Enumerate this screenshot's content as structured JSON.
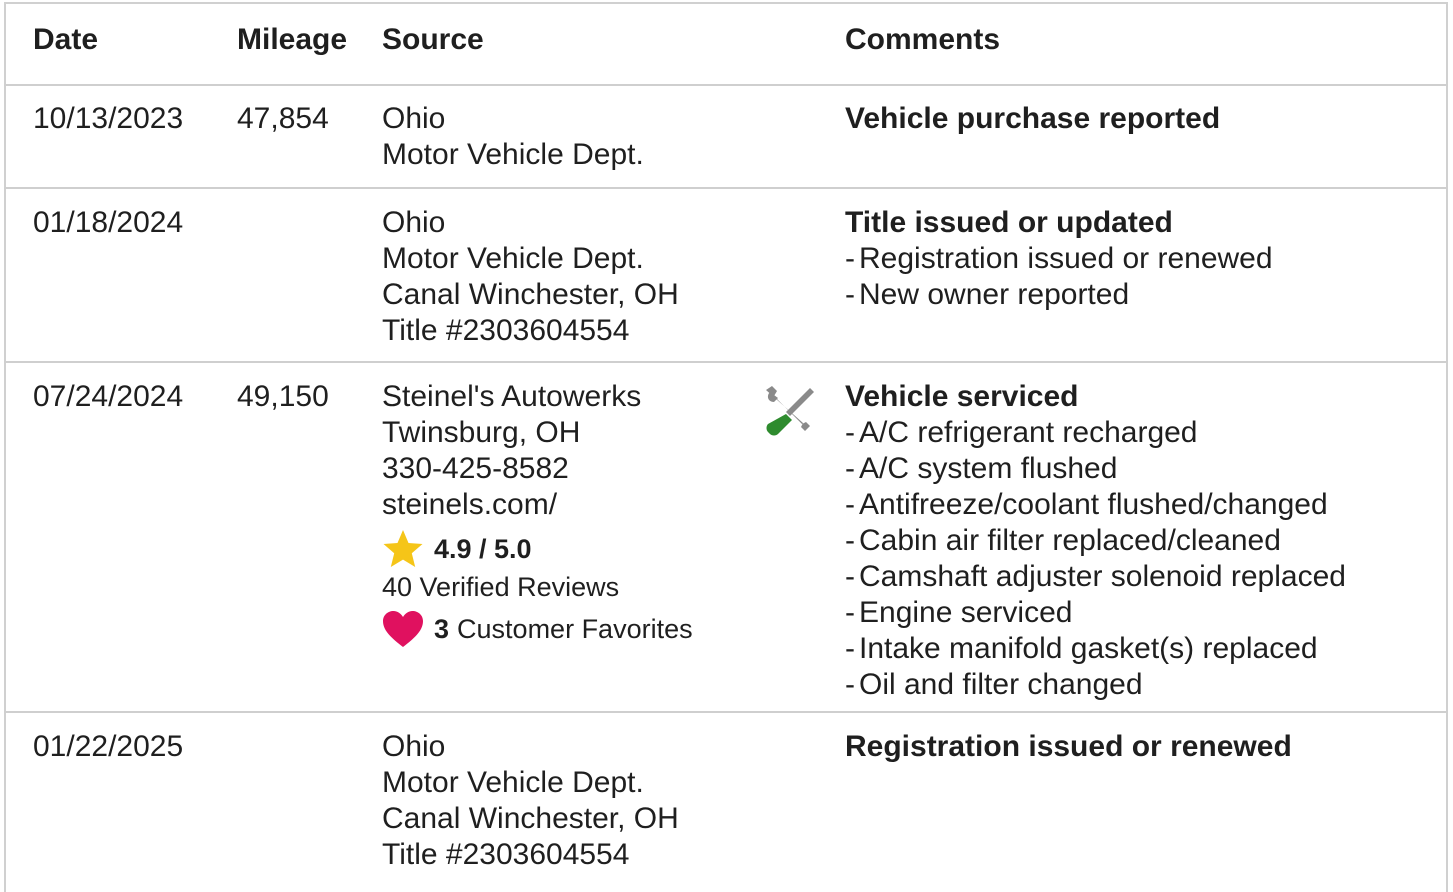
{
  "headers": {
    "date": "Date",
    "mileage": "Mileage",
    "source": "Source",
    "comments": "Comments"
  },
  "rows": [
    {
      "date": "10/13/2023",
      "mileage": "47,854",
      "source": [
        "Ohio",
        "Motor Vehicle Dept."
      ],
      "comment_title": "Vehicle purchase reported",
      "comment_items": []
    },
    {
      "date": "01/18/2024",
      "mileage": "",
      "source": [
        "Ohio",
        "Motor Vehicle Dept.",
        "Canal Winchester, OH",
        "Title #2303604554"
      ],
      "comment_title": "Title issued or updated",
      "comment_items": [
        "Registration issued or renewed",
        "New owner reported"
      ]
    },
    {
      "date": "07/24/2024",
      "mileage": "49,150",
      "source": [
        "Steinel's Autowerks",
        "Twinsburg, OH",
        "330-425-8582",
        "steinels.com/"
      ],
      "rating": "4.9 / 5.0",
      "reviews": "40 Verified Reviews",
      "favorites_count": "3",
      "favorites_label": "Customer Favorites",
      "icons": [
        "star-icon",
        "heart-icon",
        "wrench-screwdriver-icon"
      ],
      "comment_title": "Vehicle serviced",
      "comment_items": [
        "A/C refrigerant recharged",
        "A/C system flushed",
        "Antifreeze/coolant flushed/changed",
        "Cabin air filter replaced/cleaned",
        "Camshaft adjuster solenoid replaced",
        "Engine serviced",
        "Intake manifold gasket(s) replaced",
        "Oil and filter changed"
      ]
    },
    {
      "date": "01/22/2025",
      "mileage": "",
      "source": [
        "Ohio",
        "Motor Vehicle Dept.",
        "Canal Winchester, OH",
        "Title #2303604554"
      ],
      "comment_title": "Registration issued or renewed",
      "comment_items": []
    }
  ],
  "bullet_dash": "-",
  "colors": {
    "star": "#F5C518",
    "heart": "#E0115F",
    "border": "#CFCFCF",
    "screwdriver": "#2E8B2E"
  }
}
